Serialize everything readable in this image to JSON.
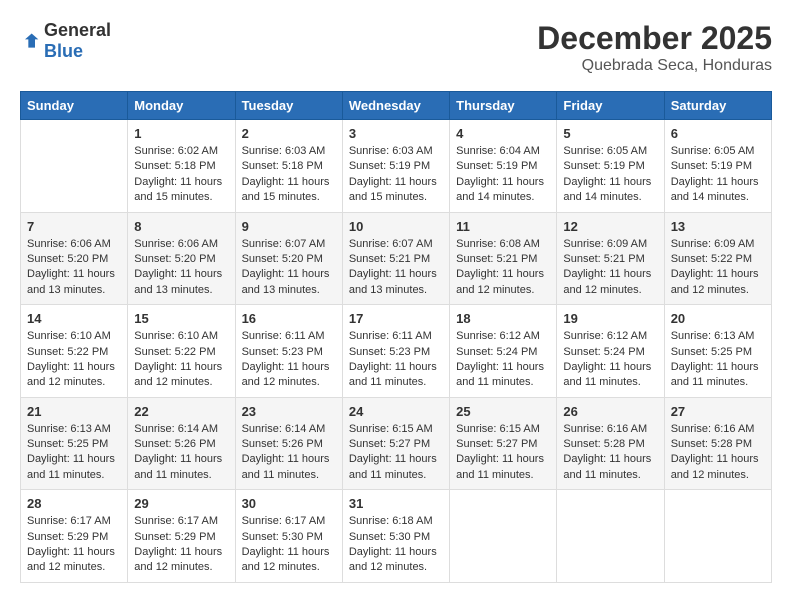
{
  "logo": {
    "general": "General",
    "blue": "Blue"
  },
  "header": {
    "month": "December 2025",
    "location": "Quebrada Seca, Honduras"
  },
  "days_of_week": [
    "Sunday",
    "Monday",
    "Tuesday",
    "Wednesday",
    "Thursday",
    "Friday",
    "Saturday"
  ],
  "weeks": [
    [
      {
        "day": "",
        "info": ""
      },
      {
        "day": "1",
        "info": "Sunrise: 6:02 AM\nSunset: 5:18 PM\nDaylight: 11 hours\nand 15 minutes."
      },
      {
        "day": "2",
        "info": "Sunrise: 6:03 AM\nSunset: 5:18 PM\nDaylight: 11 hours\nand 15 minutes."
      },
      {
        "day": "3",
        "info": "Sunrise: 6:03 AM\nSunset: 5:19 PM\nDaylight: 11 hours\nand 15 minutes."
      },
      {
        "day": "4",
        "info": "Sunrise: 6:04 AM\nSunset: 5:19 PM\nDaylight: 11 hours\nand 14 minutes."
      },
      {
        "day": "5",
        "info": "Sunrise: 6:05 AM\nSunset: 5:19 PM\nDaylight: 11 hours\nand 14 minutes."
      },
      {
        "day": "6",
        "info": "Sunrise: 6:05 AM\nSunset: 5:19 PM\nDaylight: 11 hours\nand 14 minutes."
      }
    ],
    [
      {
        "day": "7",
        "info": "Sunrise: 6:06 AM\nSunset: 5:20 PM\nDaylight: 11 hours\nand 13 minutes."
      },
      {
        "day": "8",
        "info": "Sunrise: 6:06 AM\nSunset: 5:20 PM\nDaylight: 11 hours\nand 13 minutes."
      },
      {
        "day": "9",
        "info": "Sunrise: 6:07 AM\nSunset: 5:20 PM\nDaylight: 11 hours\nand 13 minutes."
      },
      {
        "day": "10",
        "info": "Sunrise: 6:07 AM\nSunset: 5:21 PM\nDaylight: 11 hours\nand 13 minutes."
      },
      {
        "day": "11",
        "info": "Sunrise: 6:08 AM\nSunset: 5:21 PM\nDaylight: 11 hours\nand 12 minutes."
      },
      {
        "day": "12",
        "info": "Sunrise: 6:09 AM\nSunset: 5:21 PM\nDaylight: 11 hours\nand 12 minutes."
      },
      {
        "day": "13",
        "info": "Sunrise: 6:09 AM\nSunset: 5:22 PM\nDaylight: 11 hours\nand 12 minutes."
      }
    ],
    [
      {
        "day": "14",
        "info": "Sunrise: 6:10 AM\nSunset: 5:22 PM\nDaylight: 11 hours\nand 12 minutes."
      },
      {
        "day": "15",
        "info": "Sunrise: 6:10 AM\nSunset: 5:22 PM\nDaylight: 11 hours\nand 12 minutes."
      },
      {
        "day": "16",
        "info": "Sunrise: 6:11 AM\nSunset: 5:23 PM\nDaylight: 11 hours\nand 12 minutes."
      },
      {
        "day": "17",
        "info": "Sunrise: 6:11 AM\nSunset: 5:23 PM\nDaylight: 11 hours\nand 11 minutes."
      },
      {
        "day": "18",
        "info": "Sunrise: 6:12 AM\nSunset: 5:24 PM\nDaylight: 11 hours\nand 11 minutes."
      },
      {
        "day": "19",
        "info": "Sunrise: 6:12 AM\nSunset: 5:24 PM\nDaylight: 11 hours\nand 11 minutes."
      },
      {
        "day": "20",
        "info": "Sunrise: 6:13 AM\nSunset: 5:25 PM\nDaylight: 11 hours\nand 11 minutes."
      }
    ],
    [
      {
        "day": "21",
        "info": "Sunrise: 6:13 AM\nSunset: 5:25 PM\nDaylight: 11 hours\nand 11 minutes."
      },
      {
        "day": "22",
        "info": "Sunrise: 6:14 AM\nSunset: 5:26 PM\nDaylight: 11 hours\nand 11 minutes."
      },
      {
        "day": "23",
        "info": "Sunrise: 6:14 AM\nSunset: 5:26 PM\nDaylight: 11 hours\nand 11 minutes."
      },
      {
        "day": "24",
        "info": "Sunrise: 6:15 AM\nSunset: 5:27 PM\nDaylight: 11 hours\nand 11 minutes."
      },
      {
        "day": "25",
        "info": "Sunrise: 6:15 AM\nSunset: 5:27 PM\nDaylight: 11 hours\nand 11 minutes."
      },
      {
        "day": "26",
        "info": "Sunrise: 6:16 AM\nSunset: 5:28 PM\nDaylight: 11 hours\nand 11 minutes."
      },
      {
        "day": "27",
        "info": "Sunrise: 6:16 AM\nSunset: 5:28 PM\nDaylight: 11 hours\nand 12 minutes."
      }
    ],
    [
      {
        "day": "28",
        "info": "Sunrise: 6:17 AM\nSunset: 5:29 PM\nDaylight: 11 hours\nand 12 minutes."
      },
      {
        "day": "29",
        "info": "Sunrise: 6:17 AM\nSunset: 5:29 PM\nDaylight: 11 hours\nand 12 minutes."
      },
      {
        "day": "30",
        "info": "Sunrise: 6:17 AM\nSunset: 5:30 PM\nDaylight: 11 hours\nand 12 minutes."
      },
      {
        "day": "31",
        "info": "Sunrise: 6:18 AM\nSunset: 5:30 PM\nDaylight: 11 hours\nand 12 minutes."
      },
      {
        "day": "",
        "info": ""
      },
      {
        "day": "",
        "info": ""
      },
      {
        "day": "",
        "info": ""
      }
    ]
  ]
}
